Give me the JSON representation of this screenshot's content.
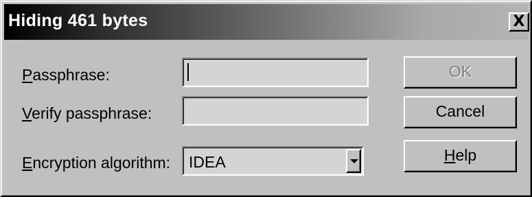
{
  "dialog": {
    "title": "Hiding 461 bytes",
    "close_glyph": "X",
    "close_icon": "close-icon"
  },
  "form": {
    "passphrase": {
      "label_accel": "P",
      "label_rest": "assphrase:",
      "value": ""
    },
    "verify": {
      "label_accel": "V",
      "label_rest": "erify passphrase:",
      "value": ""
    },
    "algorithm": {
      "label_accel": "E",
      "label_rest": "ncryption algorithm:",
      "selected": "IDEA",
      "dropdown_icon": "chevron-down-icon"
    }
  },
  "buttons": {
    "ok": {
      "label": "OK",
      "enabled": false
    },
    "cancel": {
      "label": "Cancel"
    },
    "help": {
      "label_accel": "H",
      "label_rest": "elp"
    }
  },
  "colors": {
    "face": "#c0c0c0",
    "title_gradient_start": "#000000",
    "title_gradient_end": "#b4b4b4",
    "field_bg": "#d4d4d4",
    "disabled_text": "#808080"
  }
}
